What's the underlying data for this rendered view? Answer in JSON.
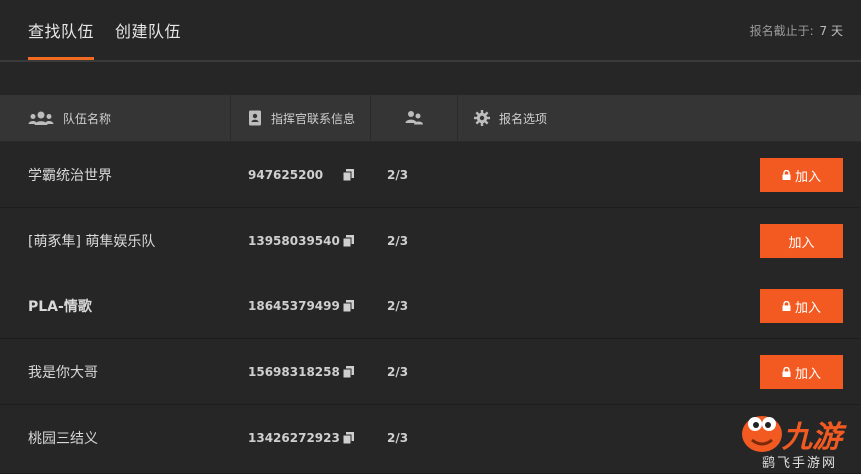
{
  "tabs": [
    {
      "label": "查找队伍",
      "active": true
    },
    {
      "label": "创建队伍",
      "active": false
    }
  ],
  "deadline": {
    "label": "报名截止于:",
    "value": "7 天"
  },
  "columns": {
    "team_name": {
      "label": "队伍名称",
      "icon": "group-icon"
    },
    "contact": {
      "label": "指挥官联系信息",
      "icon": "contact-card-icon"
    },
    "members": {
      "label": "",
      "icon": "members-icon"
    },
    "options": {
      "label": "报名选项",
      "icon": "gear-icon"
    }
  },
  "rows": [
    {
      "name": "学霸统治世界",
      "contact": "947625200",
      "count": "2/3",
      "join": "加入",
      "locked": true
    },
    {
      "name": "[萌豖隼] 萌隼娱乐队",
      "contact": "13958039540",
      "count": "2/3",
      "join": "加入",
      "locked": false
    },
    {
      "name": "PLA-情歌",
      "contact": "18645379499",
      "count": "2/3",
      "join": "加入",
      "locked": true
    },
    {
      "name": "我是你大哥",
      "contact": "15698318258",
      "count": "2/3",
      "join": "加入",
      "locked": true
    },
    {
      "name": "桃园三结义",
      "contact": "13426272923",
      "count": "2/3",
      "join": "",
      "locked": false
    }
  ],
  "watermark": {
    "brand": "九游",
    "site": "鹞飞手游网"
  },
  "colors": {
    "accent": "#f25a22",
    "background": "#262626",
    "header": "#353535"
  }
}
